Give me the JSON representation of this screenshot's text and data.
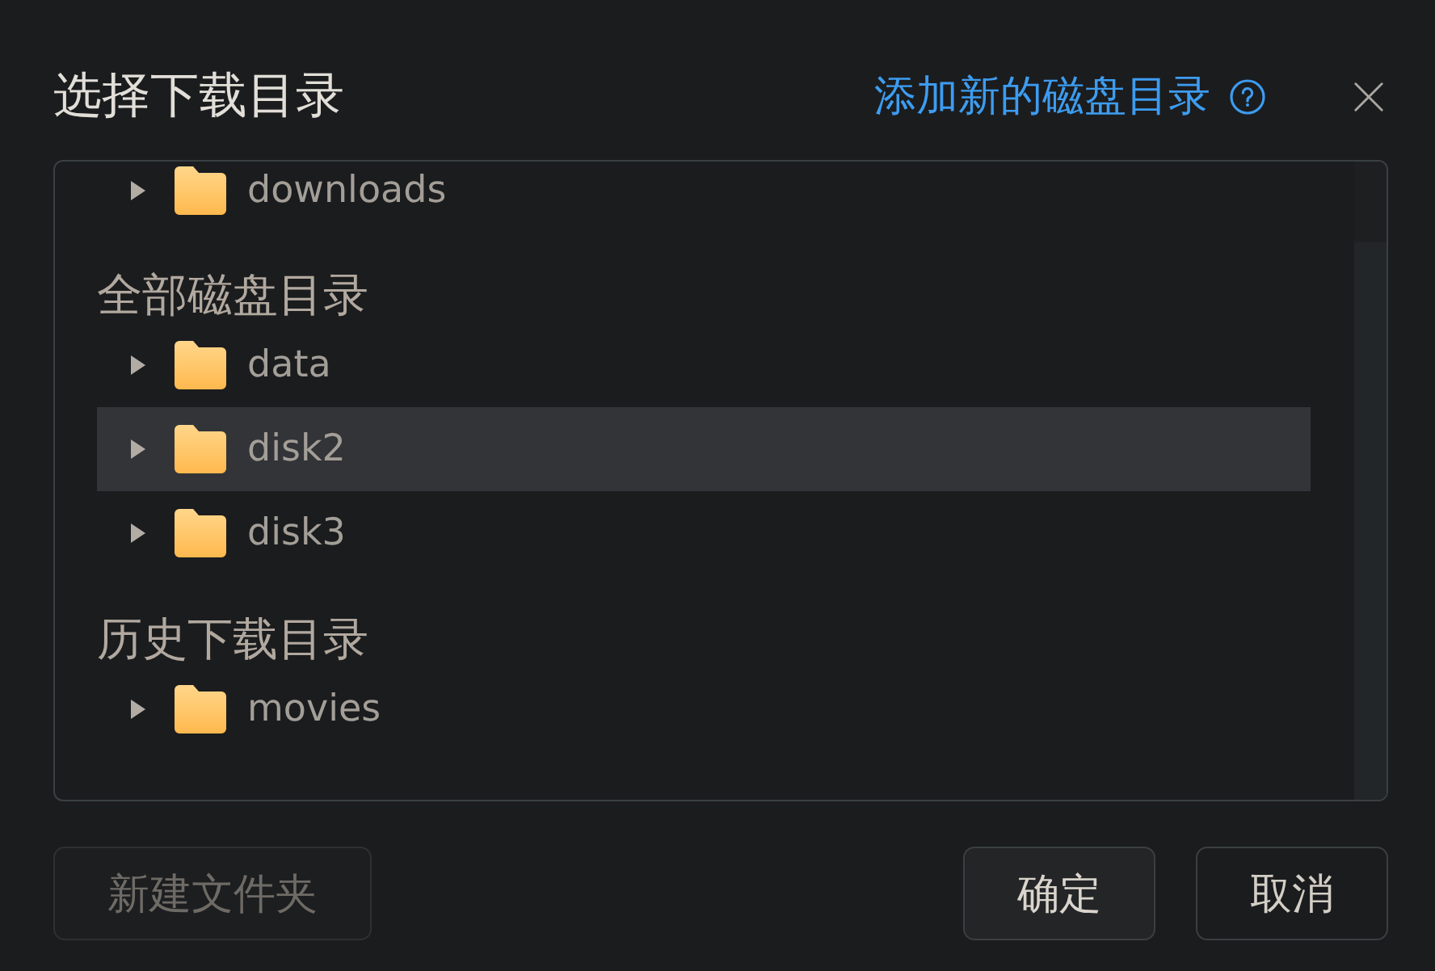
{
  "dialog": {
    "title": "选择下载目录",
    "add_disk_link": "添加新的磁盘目录"
  },
  "tree": {
    "sections": [
      {
        "items": [
          {
            "name": "downloads",
            "expanded": false,
            "selected": false
          }
        ]
      },
      {
        "heading": "全部磁盘目录",
        "items": [
          {
            "name": "data",
            "expanded": false,
            "selected": false
          },
          {
            "name": "disk2",
            "expanded": false,
            "selected": true
          },
          {
            "name": "disk3",
            "expanded": false,
            "selected": false
          }
        ]
      },
      {
        "heading": "历史下载目录",
        "items": [
          {
            "name": "movies",
            "expanded": false,
            "selected": false
          }
        ]
      }
    ]
  },
  "footer": {
    "new_folder_button": {
      "label": "新建文件夹",
      "disabled": true
    },
    "buttons": [
      {
        "label": "确定",
        "kind": "primary"
      },
      {
        "label": "取消",
        "kind": "default"
      }
    ]
  }
}
